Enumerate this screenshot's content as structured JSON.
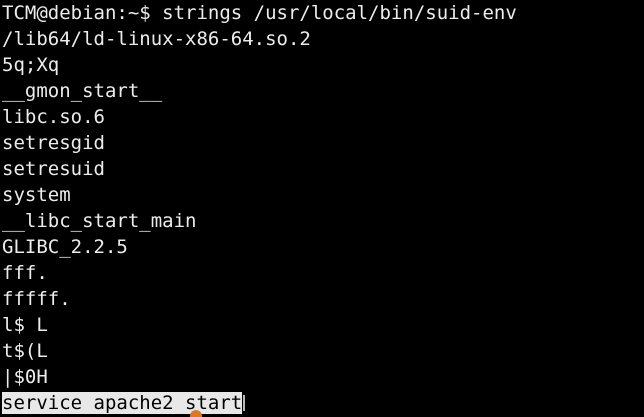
{
  "terminal": {
    "prompt": "TCM@debian:~$ ",
    "command": "strings /usr/local/bin/suid-env",
    "output": [
      "/lib64/ld-linux-x86-64.so.2",
      "5q;Xq",
      "__gmon_start__",
      "libc.so.6",
      "setresgid",
      "setresuid",
      "system",
      "__libc_start_main",
      "GLIBC_2.2.5",
      "fff.",
      "fffff.",
      "l$ L",
      "t$(L",
      "|$0H"
    ],
    "selected_line": "service apache2 start",
    "colors": {
      "background": "#000000",
      "foreground": "#ececec",
      "selection_bg": "#e8e8e8",
      "selection_fg": "#000000",
      "accent": "#d97a2b"
    }
  }
}
